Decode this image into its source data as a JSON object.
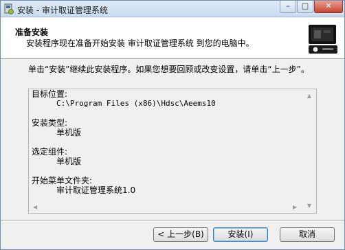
{
  "window": {
    "title": "安装 - 审计取证管理系统",
    "controls": {
      "minimize_glyph": "–",
      "maximize_glyph": "□",
      "close_glyph": "✕"
    }
  },
  "header": {
    "title": "准备安装",
    "subtitle": "安装程序现在准备开始安装 审计取证管理系统 到您的电脑中。",
    "logo_icon": "installer-computer-icon"
  },
  "intro_text": "单击“安装”继续此安装程序。如果您想要回顾或改变设置，请单击“上一步”。",
  "summary": {
    "target_label": "目标位置:",
    "target_value": "C:\\Program Files (x86)\\Hdsc\\Aeems10",
    "type_label": "安装类型:",
    "type_value": "单机版",
    "components_label": "选定组件:",
    "components_value": "单机版",
    "start_menu_label": "开始菜单文件夹:",
    "start_menu_value": "审计取证管理系统1.0"
  },
  "buttons": {
    "back": "< 上一步(B)",
    "install": "安装(I)",
    "cancel": "取消"
  },
  "colors": {
    "dialog_bg": "#f0f0f0",
    "header_bg": "#ffffff",
    "titlebar": "#c9dcef",
    "close_button": "#c8452f"
  }
}
